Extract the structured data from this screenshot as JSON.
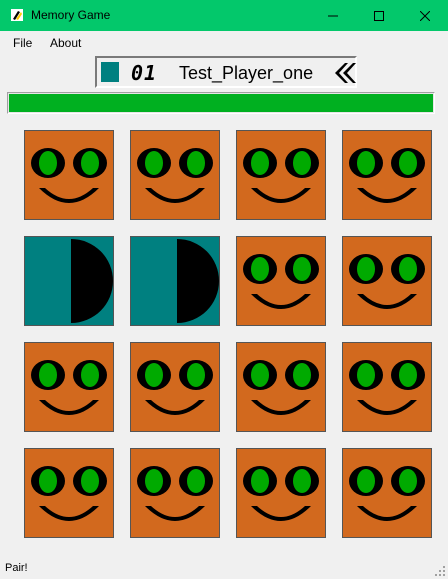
{
  "window": {
    "title": "Memory Game",
    "titlebar_color": "#03c86b"
  },
  "menu": {
    "file": "File",
    "about": "About"
  },
  "player": {
    "number": "01",
    "name": "Test_Player_one",
    "color": "#008080"
  },
  "progress": {
    "fraction": 1.0,
    "color": "#00b020"
  },
  "status": {
    "text": "Pair!"
  },
  "icons": {
    "app": "app-icon",
    "minimize": "minimize-icon",
    "maximize": "maximize-icon",
    "close": "close-icon",
    "back": "double-chevron-left-icon",
    "face_down": "smiley-face-icon",
    "face_up": "half-moon-icon"
  },
  "colors": {
    "card_back": "#d2691e",
    "card_front": "#008080",
    "eye_iris": "#00aa00",
    "symbol": "#000000"
  },
  "cards": [
    {
      "state": "hidden"
    },
    {
      "state": "hidden"
    },
    {
      "state": "hidden"
    },
    {
      "state": "hidden"
    },
    {
      "state": "revealed",
      "symbol": "half-moon"
    },
    {
      "state": "revealed",
      "symbol": "half-moon"
    },
    {
      "state": "hidden"
    },
    {
      "state": "hidden"
    },
    {
      "state": "hidden"
    },
    {
      "state": "hidden"
    },
    {
      "state": "hidden"
    },
    {
      "state": "hidden"
    },
    {
      "state": "hidden"
    },
    {
      "state": "hidden"
    },
    {
      "state": "hidden"
    },
    {
      "state": "hidden"
    }
  ]
}
